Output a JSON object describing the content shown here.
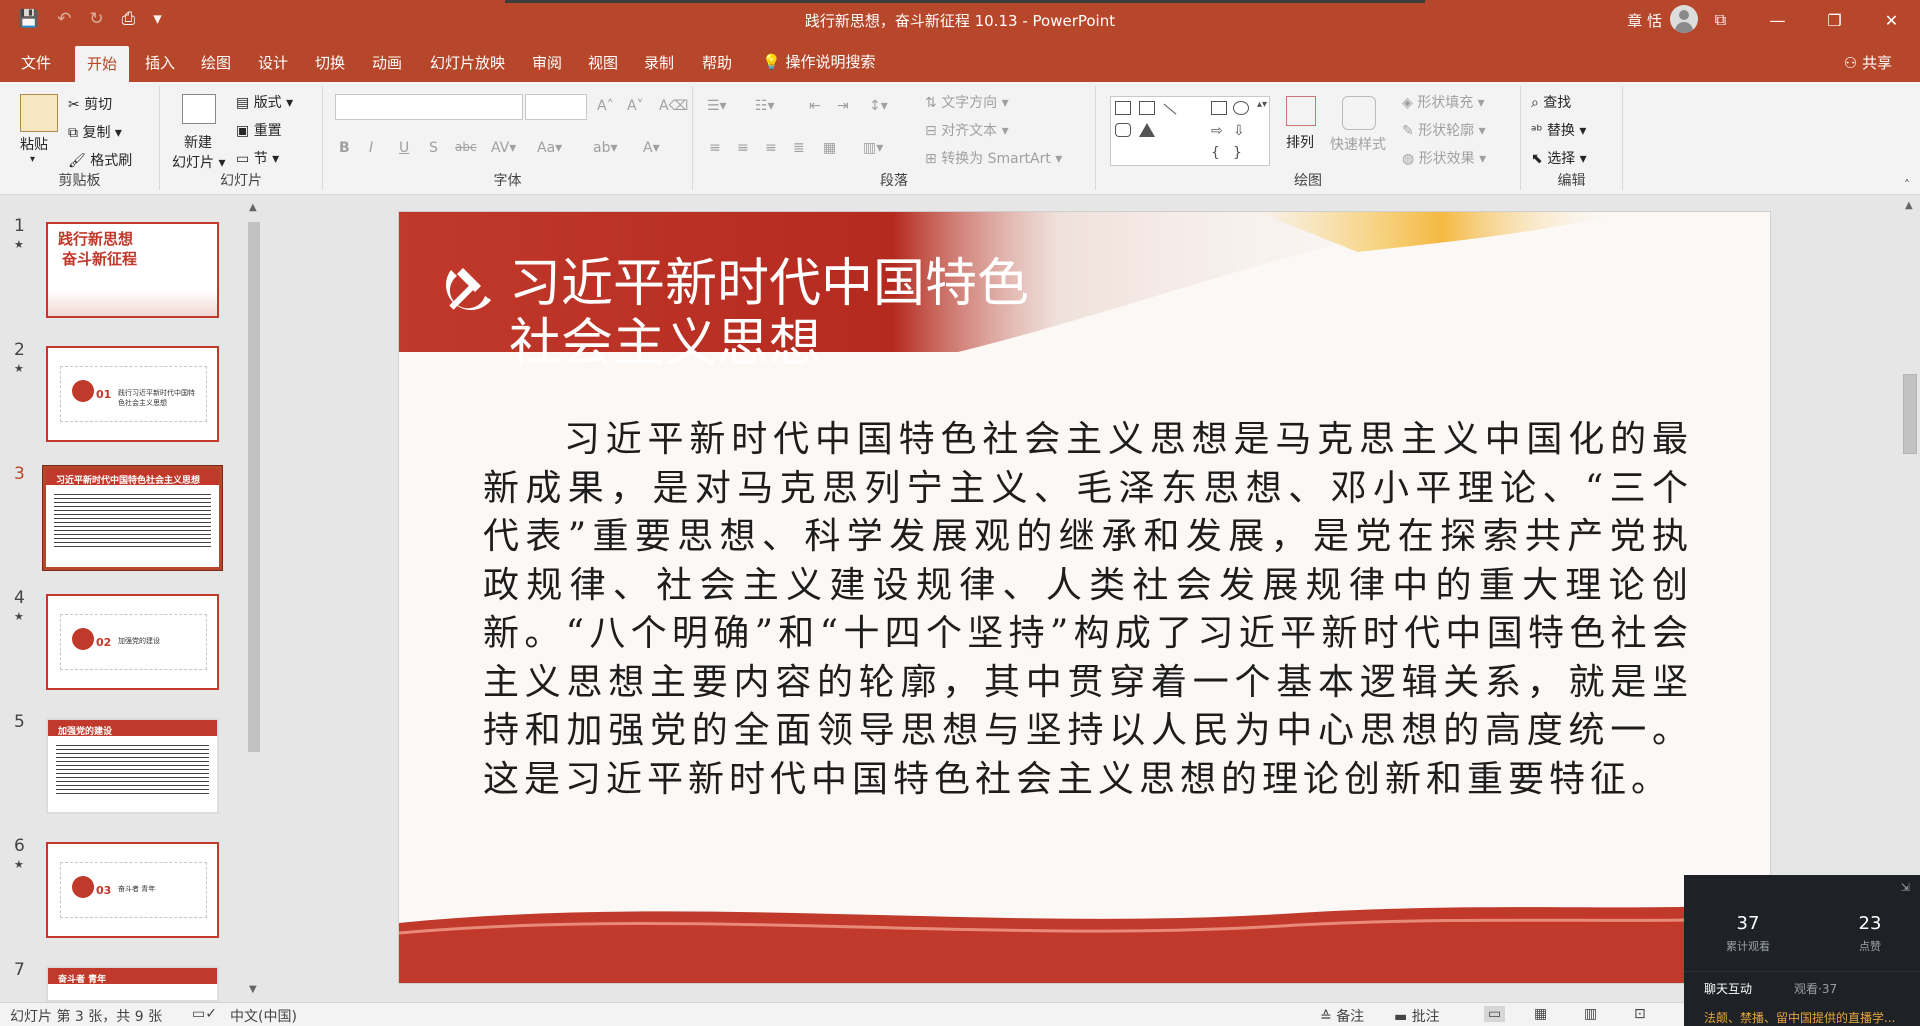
{
  "window": {
    "title": "践行新思想，奋斗新征程 10.13  -  PowerPoint",
    "user_name": "章 恬",
    "minimize": "—",
    "restore": "❐",
    "close": "✕",
    "ribbon_display": "⧉"
  },
  "qat": {
    "save": "💾",
    "undo": "↶",
    "redo": "↻",
    "present": "⎙",
    "more": "▾"
  },
  "tabs": [
    {
      "label": "文件"
    },
    {
      "label": "开始"
    },
    {
      "label": "插入"
    },
    {
      "label": "绘图"
    },
    {
      "label": "设计"
    },
    {
      "label": "切换"
    },
    {
      "label": "动画"
    },
    {
      "label": "幻灯片放映"
    },
    {
      "label": "审阅"
    },
    {
      "label": "视图"
    },
    {
      "label": "录制"
    },
    {
      "label": "帮助"
    }
  ],
  "tell_me": "操作说明搜索",
  "share": "共享",
  "ribbon": {
    "clipboard": {
      "label": "剪贴板",
      "paste": "粘贴",
      "cut": "剪切",
      "copy": "复制",
      "format_painter": "格式刷"
    },
    "slides": {
      "label": "幻灯片",
      "new_slide": "新建",
      "new_slide2": "幻灯片",
      "layout": "版式",
      "reset": "重置",
      "section": "节"
    },
    "font": {
      "label": "字体"
    },
    "paragraph": {
      "label": "段落",
      "text_direction": "文字方向",
      "align_text": "对齐文本",
      "smartart": "转换为 SmartArt"
    },
    "drawing": {
      "label": "绘图",
      "arrange": "排列",
      "quick_styles": "快速样式",
      "shape_fill": "形状填充",
      "shape_outline": "形状轮廓",
      "shape_effects": "形状效果"
    },
    "editing": {
      "label": "编辑",
      "find": "查找",
      "replace": "替换",
      "select": "选择"
    }
  },
  "thumbnails": [
    {
      "num": "1",
      "title1": "践行新思想",
      "title2": "奋斗新征程"
    },
    {
      "num": "2",
      "section_num": "01",
      "text": "践行习近平新时代中国特色社会主义思想"
    },
    {
      "num": "3",
      "title": "习近平新时代中国特色社会主义思想"
    },
    {
      "num": "4",
      "section_num": "02",
      "text": "加强党的建设"
    },
    {
      "num": "5",
      "title": "加强党的建设"
    },
    {
      "num": "6",
      "section_num": "03",
      "text": "奋斗者 青年"
    },
    {
      "num": "7",
      "title": "奋斗者 青年"
    }
  ],
  "slide": {
    "title_line1": "习近平新时代中国特色",
    "title_line2": "社会主义思想",
    "body": "习近平新时代中国特色社会主义思想是马克思主义中国化的最新成果，是对马克思列宁主义、毛泽东思想、邓小平理论、“三个代表”重要思想、科学发展观的继承和发展，是党在探索共产党执政规律、社会主义建设规律、人类社会发展规律中的重大理论创新。“八个明确”和“十四个坚持”构成了习近平新时代中国特色社会主义思想主要内容的轮廓，其中贯穿着一个基本逻辑关系，就是坚持和加强党的全面领导思想与坚持以人民为中心思想的高度统一。这是习近平新时代中国特色社会主义思想的理论创新和重要特征。"
  },
  "status": {
    "slide_info": "幻灯片 第 3 张，共 9 张",
    "language": "中文(中国)",
    "notes": "备注",
    "comments": "批注"
  },
  "live_panel": {
    "views_num": "37",
    "views_label": "累计观看",
    "likes_num": "23",
    "likes_label": "点赞",
    "tab_chat": "聊天互动",
    "tab_viewers": "观看·37",
    "note": "法颠、禁播、留中国提供的直播学..."
  },
  "colors": {
    "accent": "#b7472a",
    "party_red": "#c0392b"
  }
}
